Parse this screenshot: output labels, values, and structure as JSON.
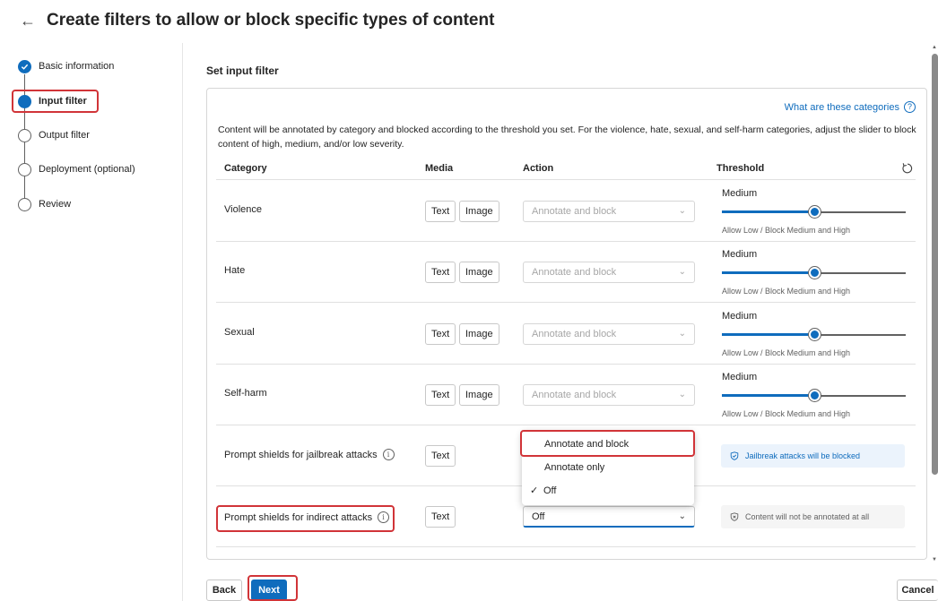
{
  "header": {
    "title": "Create filters to allow or block specific types of content"
  },
  "stepper": {
    "steps": [
      {
        "label": "Basic information",
        "state": "done"
      },
      {
        "label": "Input filter",
        "state": "current"
      },
      {
        "label": "Output filter",
        "state": "pending"
      },
      {
        "label": "Deployment (optional)",
        "state": "pending"
      },
      {
        "label": "Review",
        "state": "pending"
      }
    ]
  },
  "main": {
    "section_title": "Set input filter",
    "help_link": "What are these categories",
    "description": "Content will be annotated by category and blocked according to the threshold you set. For the violence, hate, sexual, and self-harm categories, adjust the slider to block content of high, medium, and/or low severity.",
    "columns": {
      "category": "Category",
      "media": "Media",
      "action": "Action",
      "threshold": "Threshold"
    },
    "media_labels": {
      "text": "Text",
      "image": "Image"
    },
    "rows": [
      {
        "category": "Violence",
        "action": "Annotate and block",
        "threshold": "Medium",
        "threshold_level": 0.5,
        "threshold_desc": "Allow Low / Block Medium and High"
      },
      {
        "category": "Hate",
        "action": "Annotate and block",
        "threshold": "Medium",
        "threshold_level": 0.5,
        "threshold_desc": "Allow Low / Block Medium and High"
      },
      {
        "category": "Sexual",
        "action": "Annotate and block",
        "threshold": "Medium",
        "threshold_level": 0.5,
        "threshold_desc": "Allow Low / Block Medium and High"
      },
      {
        "category": "Self-harm",
        "action": "Annotate and block",
        "threshold": "Medium",
        "threshold_level": 0.5,
        "threshold_desc": "Allow Low / Block Medium and High"
      }
    ],
    "jailbreak": {
      "category": "Prompt shields for jailbreak attacks",
      "status": "Jailbreak attacks will be blocked"
    },
    "indirect": {
      "category": "Prompt shields for indirect attacks",
      "action": "Off",
      "status": "Content will not be annotated at all"
    },
    "dropdown": {
      "options": [
        "Annotate and block",
        "Annotate only",
        "Off"
      ],
      "selected": "Off"
    }
  },
  "footer": {
    "back": "Back",
    "next": "Next",
    "cancel": "Cancel"
  },
  "colors": {
    "accent": "#0f6cbd",
    "highlight": "#d13438",
    "status_blue_bg": "#ebf3fc"
  }
}
